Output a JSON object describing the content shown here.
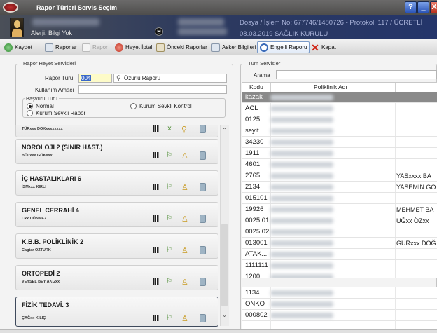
{
  "window": {
    "title": "Rapor Türleri Servis Seçim",
    "help_label": "?",
    "minimize_label": "_",
    "close_label": "X"
  },
  "patient": {
    "allergy": "Alerji: Bilgi Yok",
    "record_icon": "⦿",
    "dosya": "Dosya / İşlem No: 677746/1480726 - Protokol: 117 / ÜCRETLİ",
    "tarih": "08.03.2019 SAĞLIK KURULU"
  },
  "toolbar": {
    "items": [
      {
        "label": "Kaydet",
        "icon": "save-icon"
      },
      {
        "label": "Raporlar",
        "icon": "document-icon"
      },
      {
        "label": "Rapor",
        "icon": "search-icon"
      },
      {
        "label": "Heyet İptal",
        "icon": "cancel-icon"
      },
      {
        "label": "Önceki Raporlar",
        "icon": "copy-icon"
      },
      {
        "label": "Asker Bilgileri",
        "icon": "document-icon"
      },
      {
        "label": "Engelli Raporu",
        "icon": "refresh-icon"
      },
      {
        "label": "Kapat",
        "icon": "close-icon"
      }
    ]
  },
  "left_panel": {
    "group_title": "Rapor Heyet Servisleri",
    "rapor_turu_label": "Rapor Türü",
    "rapor_turu_code": "004",
    "rapor_turu_name": "Özürlü Raporu",
    "kullanim_amaci_label": "Kullanım Amacı",
    "kullanim_amaci_value": "",
    "basvuru_turu_label": "Başvuru Türü",
    "radio_normal": "Normal",
    "radio_kurum_sevkli_rapor": "Kurum Sevkli Rapor",
    "radio_kurum_sevkli_kontrol": "Kurum Sevkli Kontrol",
    "partial_doctor": "TÜRxxx DOKxxxxxxxx",
    "cards": [
      {
        "title": "NÖROLOJİ 2 (SİNİR HAST.)",
        "doctor": "BÜLxxx GÖKxxx"
      },
      {
        "title": "İÇ HASTALIKLARI 6",
        "doctor": "İSMxxx KIRLI"
      },
      {
        "title": "GENEL CERRAHİ 4",
        "doctor": "Cxx DÖNMEZ"
      },
      {
        "title": "K.B.B. POLİKLİNİK 2",
        "doctor": "Cagtar OZTURK"
      },
      {
        "title": "ORTOPEDİ 2",
        "doctor": "VEYSEL BEY AKGxx"
      },
      {
        "title": "FİZİK TEDAVİ. 3",
        "doctor": "ÇAĞxx KILIÇ"
      }
    ],
    "scroll_up": "⌃",
    "scroll_down": "⌄"
  },
  "right_panel": {
    "group_title": "Tüm Servisler",
    "search_label": "Arama",
    "search_value": "",
    "col_kodu": "Kodu",
    "col_adi": "Poliklinik Adı",
    "rows": [
      {
        "kod": "kazak",
        "doctor": ""
      },
      {
        "kod": "ACL",
        "doctor": ""
      },
      {
        "kod": "0125",
        "doctor": ""
      },
      {
        "kod": "seyit",
        "doctor": ""
      },
      {
        "kod": "34230",
        "doctor": ""
      },
      {
        "kod": "1911",
        "doctor": ""
      },
      {
        "kod": "4601",
        "doctor": ""
      },
      {
        "kod": "2765",
        "doctor": "YASxxxx BA"
      },
      {
        "kod": "2134",
        "doctor": "YASEMİN GÖ"
      },
      {
        "kod": "015101",
        "doctor": ""
      },
      {
        "kod": "19926",
        "doctor": "MEHMET BA"
      },
      {
        "kod": "0025.01",
        "doctor": "UĞxx ÖZxx"
      },
      {
        "kod": "0025.02",
        "doctor": ""
      },
      {
        "kod": "013001",
        "doctor": "GÜRxxx DOĞ"
      },
      {
        "kod": "ATAK...",
        "doctor": ""
      },
      {
        "kod": "1111111",
        "doctor": ""
      },
      {
        "kod": "1200",
        "doctor": ""
      },
      {
        "kod": "1134",
        "doctor": ""
      },
      {
        "kod": "ONKO",
        "doctor": ""
      },
      {
        "kod": "000802",
        "doctor": ""
      }
    ]
  }
}
